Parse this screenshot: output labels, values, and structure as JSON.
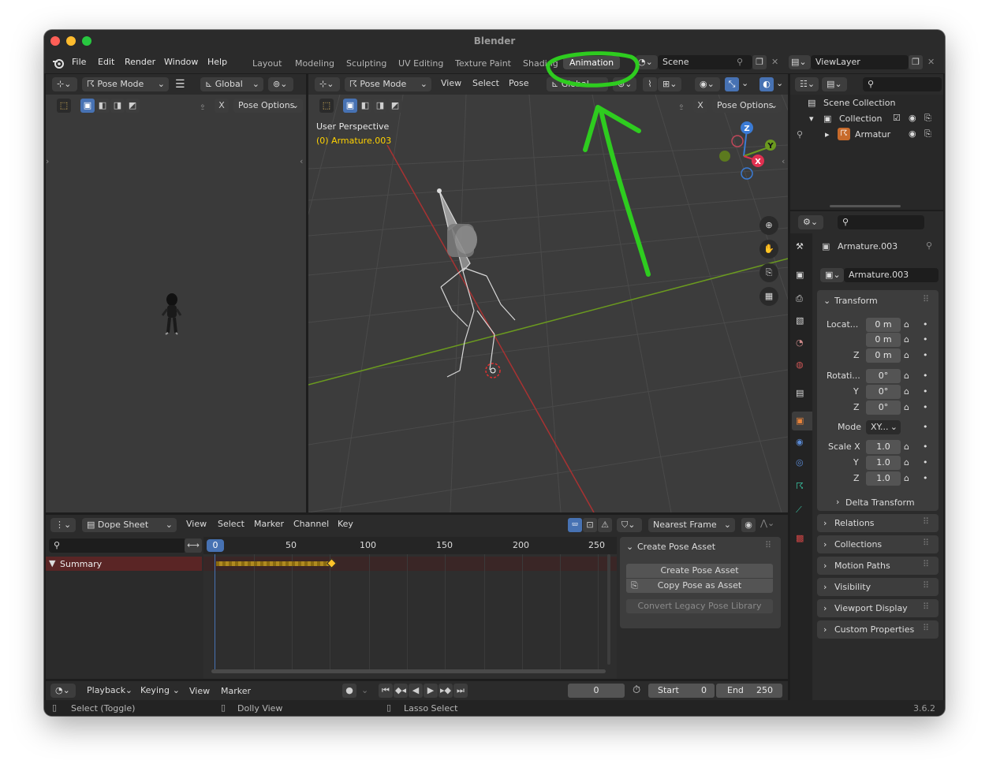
{
  "window": {
    "title": "Blender"
  },
  "menu": {
    "items": [
      "File",
      "Edit",
      "Render",
      "Window",
      "Help"
    ]
  },
  "workspaces": [
    "Layout",
    "Modeling",
    "Sculpting",
    "UV Editing",
    "Texture Paint",
    "Shading",
    "Animation"
  ],
  "scene": {
    "label": "Scene"
  },
  "viewlayer": {
    "label": "ViewLayer"
  },
  "left_view": {
    "mode": "Pose Mode",
    "orientation": "Global",
    "pose_options": "Pose Options"
  },
  "viewport": {
    "mode": "Pose Mode",
    "menus": [
      "View",
      "Select",
      "Pose"
    ],
    "orientation": "Global",
    "pose_options": "Pose Options",
    "perspective": "User Perspective",
    "object_info": "(0) Armature.003",
    "x_btn": "X"
  },
  "outliner": {
    "scene_collection": "Scene Collection",
    "collection": "Collection",
    "armature": "Armatur"
  },
  "properties": {
    "object_name": "Armature.003",
    "data_name": "Armature.003",
    "transform_label": "Transform",
    "location_label": "Locat...",
    "location": [
      "0 m",
      "0 m",
      "0 m"
    ],
    "rotation_label": "Rotati...",
    "rotation": [
      "0°",
      "0°",
      "0°"
    ],
    "mode_label": "Mode",
    "mode_value": "XY...",
    "scale_label": "Scale X",
    "scale": [
      "1.0",
      "1.0",
      "1.0"
    ],
    "axis_y": "Y",
    "axis_z": "Z",
    "sections": [
      "Delta Transform",
      "Relations",
      "Collections",
      "Motion Paths",
      "Visibility",
      "Viewport Display",
      "Custom Properties"
    ]
  },
  "dopesheet": {
    "editor": "Dope Sheet",
    "menus": [
      "View",
      "Select",
      "Marker",
      "Channel",
      "Key"
    ],
    "snap": "Nearest Frame",
    "summary": "Summary",
    "frame_ticks": [
      "0",
      "50",
      "100",
      "150",
      "200",
      "250"
    ],
    "current_frame": "0"
  },
  "pose_asset": {
    "title": "Create Pose Asset",
    "create": "Create Pose Asset",
    "copy": "Copy Pose as Asset",
    "convert": "Convert Legacy Pose Library"
  },
  "timeline": {
    "playback": "Playback",
    "keying": "Keying",
    "view": "View",
    "marker": "Marker",
    "frame": "0",
    "start_label": "Start",
    "start": "0",
    "end_label": "End",
    "end": "250"
  },
  "statusbar": {
    "select": "Select (Toggle)",
    "dolly": "Dolly View",
    "lasso": "Lasso Select",
    "version": "3.6.2"
  },
  "colors": {
    "accent": "#4772b3",
    "annotation": "#2ecc1f",
    "object_text": "#ffd200",
    "summary_bg": "#5a2525"
  }
}
